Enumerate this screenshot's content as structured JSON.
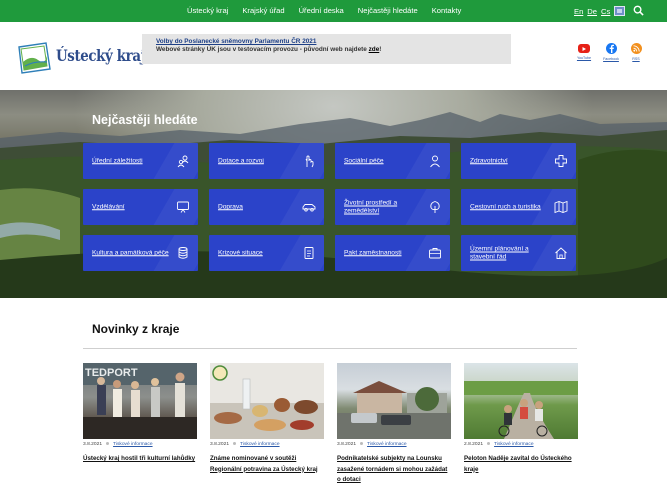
{
  "topnav": {
    "items": [
      "Ústecký kraj",
      "Krajský úřad",
      "Úřední deska",
      "Nejčastěji hledáte",
      "Kontakty"
    ],
    "langs": [
      "En",
      "De",
      "Cs"
    ],
    "search_icon": "search-icon",
    "bg_color": "#1f9a3c"
  },
  "header": {
    "logo_text": "Ústecký kraj",
    "notice": {
      "title": "Volby do Poslanecké sněmovny Parlamentu ČR 2021",
      "text": "Webové stránky ÚK jsou v testovacím provozu - původní web najdete",
      "link": "zde",
      "suffix": "!"
    },
    "social": [
      {
        "label": "YouTube",
        "icon": "youtube-icon",
        "color": "#e62117"
      },
      {
        "label": "Facebook",
        "icon": "facebook-icon",
        "color": "#1877f2"
      },
      {
        "label": "RSS",
        "icon": "rss-icon",
        "color": "#f2901e"
      }
    ]
  },
  "hero": {
    "title": "Nejčastěji hledáte",
    "tile_color": "#2b43c9",
    "tiles": [
      {
        "label": "Úřední záležitosti",
        "icon": "people-icon"
      },
      {
        "label": "Dotace a rozvoj",
        "icon": "hand-icon"
      },
      {
        "label": "Sociální péče",
        "icon": "person-icon"
      },
      {
        "label": "Zdravotnictví",
        "icon": "cross-icon"
      },
      {
        "label": "Vzdělávání",
        "icon": "board-icon"
      },
      {
        "label": "Doprava",
        "icon": "car-icon"
      },
      {
        "label": "Životní prostředí a zemědělství",
        "icon": "tree-icon"
      },
      {
        "label": "Cestovní ruch a turistika",
        "icon": "map-icon"
      },
      {
        "label": "Kultura a památková péče",
        "icon": "database-icon"
      },
      {
        "label": "Krizové situace",
        "icon": "document-icon"
      },
      {
        "label": "Pakt zaměstnanosti",
        "icon": "briefcase-icon"
      },
      {
        "label": "Územní plánování a stavební řád",
        "icon": "house-icon"
      }
    ]
  },
  "news": {
    "title": "Novinky z kraje",
    "photo_text": "TEDPORT",
    "cards": [
      {
        "date": "3.8.2021",
        "category": "Tiskové informace",
        "title": "Ústecký kraj hostil tři kulturní lahůdky"
      },
      {
        "date": "3.8.2021",
        "category": "Tiskové informace",
        "title": "Známe nominované v soutěži Regionální potravina za Ústecký kraj"
      },
      {
        "date": "3.8.2021",
        "category": "Tiskové informace",
        "title": "Podnikatelské subjekty na Lounsku zasažené tornádem si mohou zažádat o dotaci"
      },
      {
        "date": "2.8.2021",
        "category": "Tiskové informace",
        "title": "Peloton Naděje zavítal do Ústeckého kraje"
      }
    ]
  }
}
